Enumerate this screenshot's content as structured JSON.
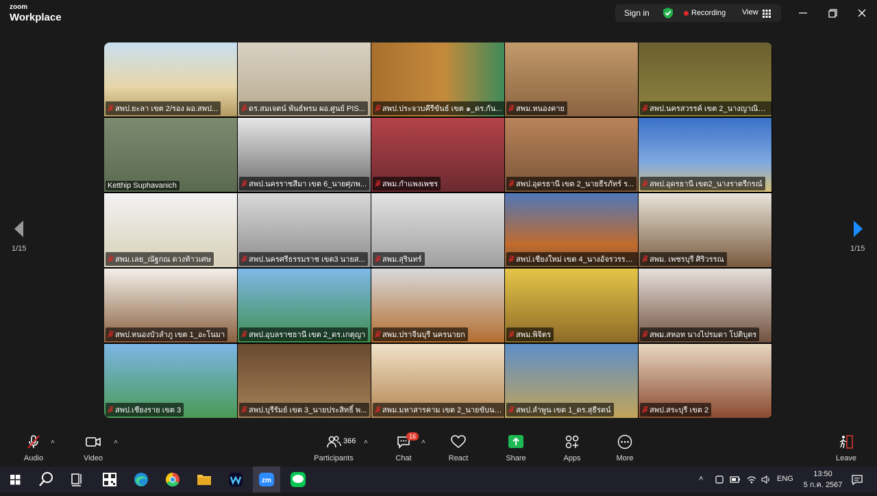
{
  "app": {
    "brand_small": "zoom",
    "brand_big": "Workplace"
  },
  "header": {
    "signin": "Sign in",
    "recording": "Recording",
    "view": "View"
  },
  "nav": {
    "page_left": "1/15",
    "page_right": "1/15"
  },
  "tiles": [
    {
      "label": "สพป.ยะลา เขต 2/รอง ผอ.สพป...",
      "muted": true
    },
    {
      "label": "ดร.สมเจตน์ พันธ์พรม ผอ.ศูนย์ PIS...",
      "muted": true
    },
    {
      "label": "สพป.ประจวบคีรีขันธ์ เขต ๑_ดร.กัน...",
      "muted": true
    },
    {
      "label": "สพม.หนองคาย",
      "muted": true
    },
    {
      "label": "สพป.นครสวรรค์ เขต 2_นางญาณินท์ จ...",
      "muted": true
    },
    {
      "label": "Ketthip Suphavanich",
      "muted": false,
      "active": true
    },
    {
      "label": "สพป.นครราชสีมา เขต 6_นายศุภพ...",
      "muted": true
    },
    {
      "label": "สพม.กำแพงเพชร",
      "muted": true
    },
    {
      "label": "สพป.อุดรธานี เขต 2_นายธีรภัทร์ ร...",
      "muted": true
    },
    {
      "label": "สพป.อุดรธานี เขต2_นางราตรีกรณ์",
      "muted": true
    },
    {
      "label": "สพม.เลย_ณัฐกณ ดวงท้าวเศษ",
      "muted": true
    },
    {
      "label": "สพป.นครศรีธรรมราช เขต3 นายส...",
      "muted": true
    },
    {
      "label": "สพม.สุรินทร์",
      "muted": true
    },
    {
      "label": "สพป.เชียงใหม่ เขต 4_นางอัจรวรรณ ...",
      "muted": true
    },
    {
      "label": "สพม. เพชรบุรี ศิริวรรณ",
      "muted": true
    },
    {
      "label": "สพป.หนองบัวลำภู เขต 1_อะโนมา",
      "muted": true
    },
    {
      "label": "สพป.อุบลราชธานี เขต 2_ดร.เกตุญา",
      "muted": true
    },
    {
      "label": "สพม.ปราจีนบุรี นครนายก",
      "muted": true
    },
    {
      "label": "สพม.พิจิตร",
      "muted": true
    },
    {
      "label": "สพม.สหอท นางไปรมดา โปติบุตร",
      "muted": true
    },
    {
      "label": "สพป.เชียงราย เขต 3",
      "muted": true
    },
    {
      "label": "สพป.บุรีรัมย์ เขต 3_นายประสิทธิ์ พ...",
      "muted": true
    },
    {
      "label": "สพม.มหาสารคาม เขต 2_นายขับนร...",
      "muted": true
    },
    {
      "label": "สพป.ลำพูน เขต 1_ดร.สุธีรตน์",
      "muted": true
    },
    {
      "label": "สพป.สระบุรี เขต 2",
      "muted": true
    }
  ],
  "toolbar": {
    "audio": "Audio",
    "video": "Video",
    "participants": "Participants",
    "participants_count": "366",
    "chat": "Chat",
    "chat_badge": "16",
    "react": "React",
    "share": "Share",
    "apps": "Apps",
    "more": "More",
    "leave": "Leave"
  },
  "taskbar": {
    "lang": "ENG",
    "time": "13:50",
    "date": "5 ก.ค. 2567"
  },
  "colors": {
    "accent_green": "#2fd15c",
    "share_green": "#1db954",
    "rec_red": "#e02828",
    "nav_blue": "#1a8cff"
  }
}
